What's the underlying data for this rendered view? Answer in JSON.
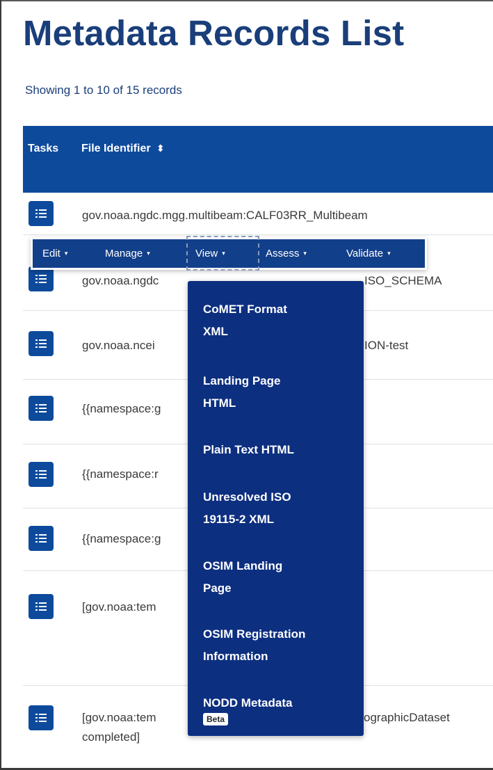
{
  "page": {
    "title": "Metadata Records List",
    "records_info": "Showing 1 to 10 of 15 records"
  },
  "table": {
    "headers": {
      "tasks": "Tasks",
      "file_identifier": "File Identifier",
      "sort_icon": "sort-icon"
    },
    "rows": [
      {
        "line1": "gov.noaa.ngdc.mgg.multibeam:CALF03RR_Multibeam",
        "line2": ""
      },
      {
        "line1": "gov.noaa.ngdc",
        "line1_right": "ISO_SCHEMA",
        "line2": ""
      },
      {
        "line1": "gov.noaa.ncei",
        "line1_right": "ION-test",
        "line2": ""
      },
      {
        "line1": "{{namespace:g",
        "line2": ""
      },
      {
        "line1": "{{namespace:r",
        "line2": ""
      },
      {
        "line1": "{{namespace:g",
        "line2": ""
      },
      {
        "line1": "[gov.noaa:tem",
        "line2": ""
      },
      {
        "line1": "[gov.noaa:tem",
        "line1_right": "ographicDataset",
        "line2": "completed]"
      }
    ]
  },
  "action_bar": {
    "tabs": [
      {
        "label": "Edit"
      },
      {
        "label": "Manage"
      },
      {
        "label": "View",
        "active": true
      },
      {
        "label": "Assess"
      },
      {
        "label": "Validate"
      }
    ],
    "caret": "▾"
  },
  "view_menu": {
    "items": [
      {
        "line1": "CoMET Format",
        "line2": "XML"
      },
      {
        "line1": "Landing Page",
        "line2": "HTML"
      },
      {
        "line1": "Plain Text HTML",
        "line2": ""
      },
      {
        "line1": "Unresolved ISO",
        "line2": "19115-2 XML"
      },
      {
        "line1": "OSIM Landing",
        "line2": "Page"
      },
      {
        "line1": "OSIM Registration",
        "line2": "Information"
      },
      {
        "line1": "NODD Metadata",
        "badge": "Beta"
      }
    ]
  },
  "colors": {
    "primary": "#0d4a9c",
    "title": "#1a3e7a",
    "menu_bg": "#0d2f80"
  }
}
